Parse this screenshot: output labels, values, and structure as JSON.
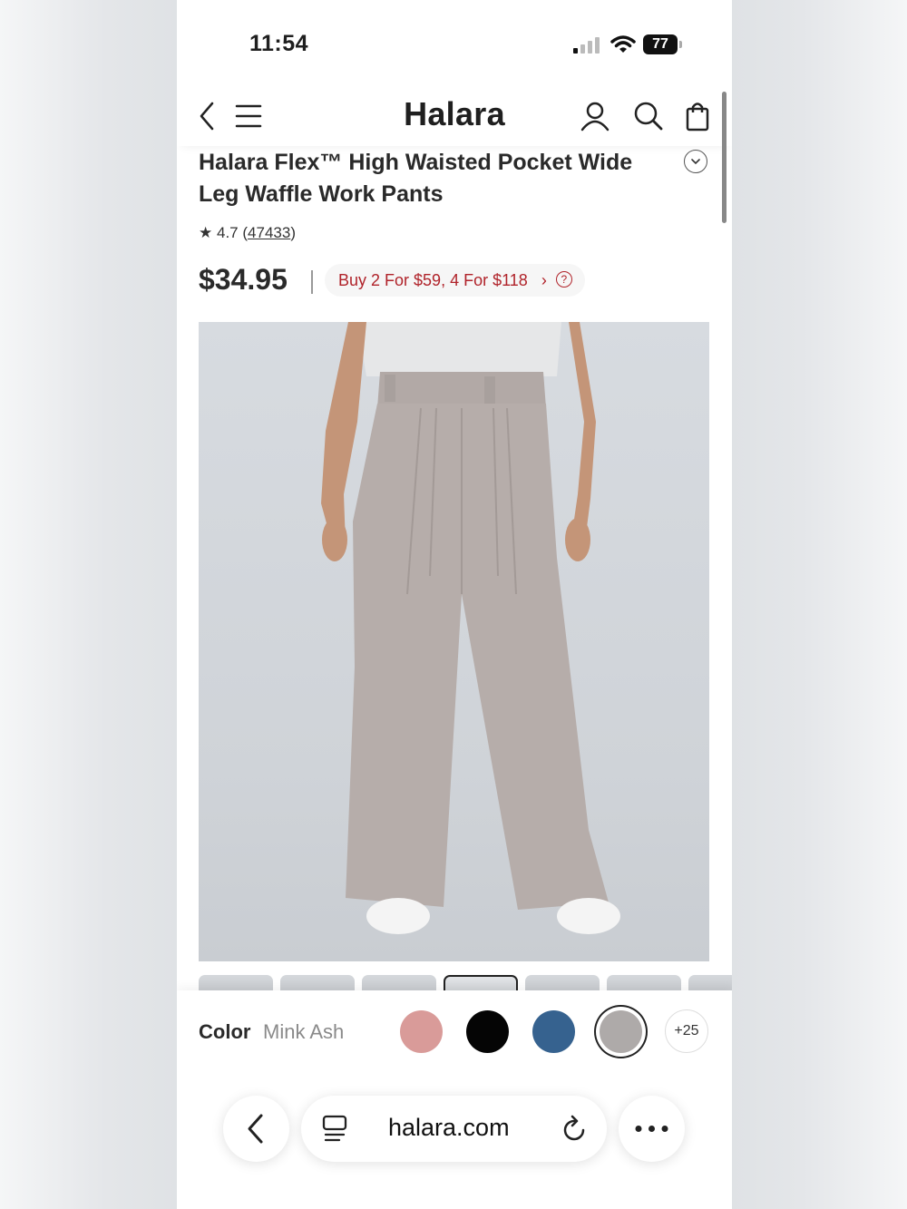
{
  "status_bar": {
    "time": "11:54",
    "battery": "77"
  },
  "header": {
    "brand": "Halara"
  },
  "product": {
    "title": "Halara Flex™ High Waisted Pocket Wide Leg Waffle Work Pants",
    "rating": "4.7",
    "review_count": "47433",
    "price": "$34.95",
    "promo": "Buy 2 For $59, 4 For $118"
  },
  "color": {
    "label": "Color",
    "selected": "Mink Ash",
    "swatches": [
      {
        "name": "pink",
        "hex": "#d99b99"
      },
      {
        "name": "black",
        "hex": "#050505"
      },
      {
        "name": "blue",
        "hex": "#36628f"
      },
      {
        "name": "mink-ash",
        "hex": "#aeaaa9"
      }
    ],
    "more": "+25"
  },
  "browser": {
    "url": "halara.com"
  },
  "colors": {
    "promo_text": "#b0232a",
    "pants": "#b6adaa"
  }
}
